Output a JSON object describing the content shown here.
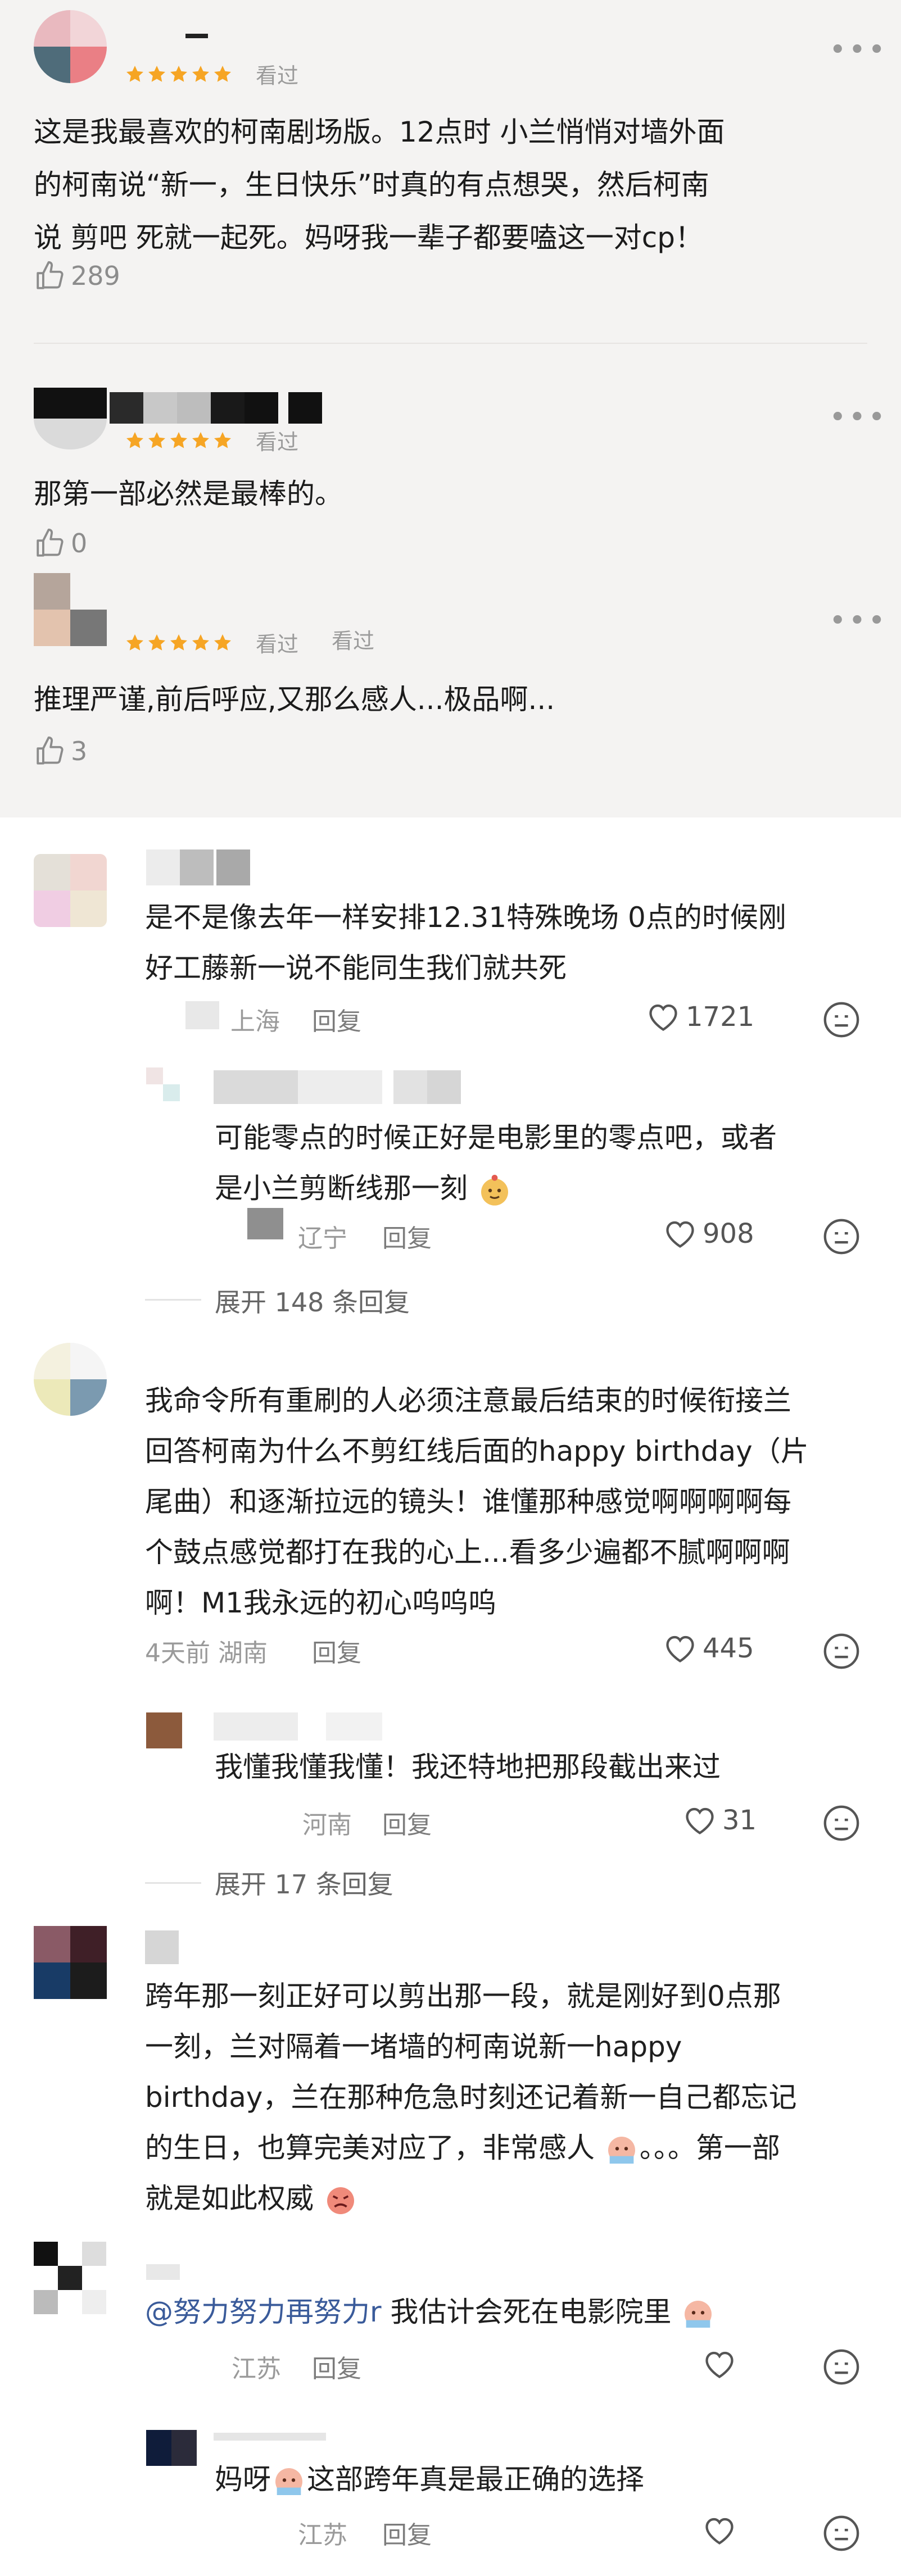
{
  "reviews": [
    {
      "seen": "看过",
      "text_lines": [
        "这是我最喜欢的柯南剧场版。12点时 小兰悄悄对墙外面",
        "的柯南说“新一，生日快乐”时真的有点想哭，然后柯南",
        "说 剪吧 死就一起死。妈呀我一辈子都要嗑这一对cp！"
      ],
      "likes": "289"
    },
    {
      "seen": "看过",
      "text_lines": [
        "那第一部必然是最棒的。"
      ],
      "likes": "0"
    },
    {
      "seen": "看过",
      "seen2": "看过",
      "text_lines": [
        "推理严谨,前后呼应,又那么感人...极品啊..."
      ],
      "likes": "3"
    }
  ],
  "comments": {
    "c1": {
      "text_lines": [
        "是不是像去年一样安排12.31特殊晚场 0点的时候刚",
        "好工藤新一说不能同生我们就共死"
      ],
      "location": "上海",
      "reply": "回复",
      "likes": "1721",
      "reply1": {
        "text_lines": [
          "可能零点的时候正好是电影里的零点吧，或者",
          "是小兰剪断线那一刻"
        ],
        "location": "辽宁",
        "reply": "回复",
        "likes": "908"
      },
      "expand": "展开 148 条回复"
    },
    "c2": {
      "text_lines": [
        "我命令所有重刷的人必须注意最后结束的时候衔接兰",
        "回答柯南为什么不剪红线后面的happy birthday（片",
        "尾曲）和逐渐拉远的镜头！谁懂那种感觉啊啊啊啊每",
        "个鼓点感觉都打在我的心上...看多少遍都不腻啊啊啊",
        "啊！M1我永远的初心呜呜呜"
      ],
      "time_location": "4天前 湖南",
      "reply": "回复",
      "likes": "445",
      "reply1": {
        "text_lines": [
          "我懂我懂我懂！我还特地把那段截出来过"
        ],
        "location": "河南",
        "reply": "回复",
        "likes": "31"
      },
      "expand": "展开 17 条回复"
    },
    "c3": {
      "text_lines": [
        "跨年那一刻正好可以剪出那一段，就是刚好到0点那",
        "一刻，兰对隔着一堵墙的柯南说新一happy",
        "birthday，兰在那种危急时刻还记着新一自己都忘记",
        "的生日，也算完美对应了，非常感人",
        "就是如此权威"
      ],
      "line4_suffix": "。。。第一部",
      "reply1": {
        "mention": "@努力努力再努力r",
        "text": " 我估计会死在电影院里",
        "location": "江苏",
        "reply": "回复"
      },
      "reply2": {
        "text_a": "妈呀",
        "text_b": "这部跨年真是最正确的选择",
        "location": "江苏",
        "reply": "回复"
      }
    }
  },
  "colors": {
    "top_bg": "#f4f3f2",
    "star": "#f6a524",
    "mention": "#3a5b9a"
  }
}
